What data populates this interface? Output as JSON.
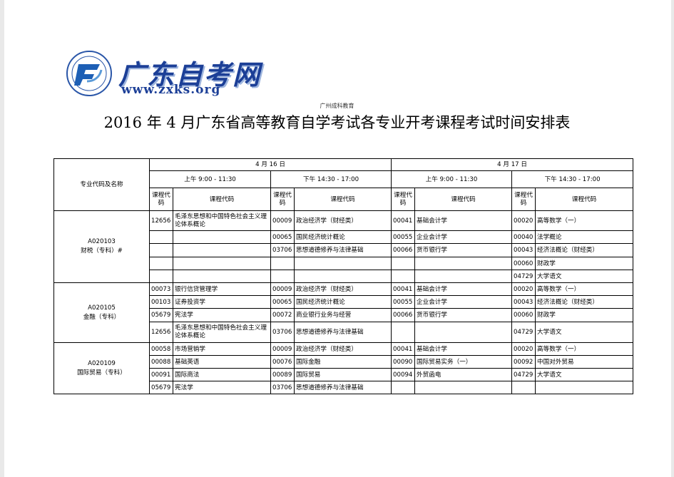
{
  "logo": {
    "title": "广东自考网",
    "url": "www.zxks.org",
    "emblem_icon": "zxks-emblem-icon"
  },
  "source_line": "广州成科教育",
  "title": "2016 年 4 月广东省高等教育自学考试各专业开考课程考试时间安排表",
  "table": {
    "major_header": "专业代码及名称",
    "days": [
      "4 月 16 日",
      "4 月 17 日"
    ],
    "sessions": [
      "上午 9:00 - 11:30",
      "下午 14:30 - 17:00",
      "上午 9:00 - 11:30",
      "下午 14:30 - 17:00"
    ],
    "code_header": "课程代码",
    "name_header": "课程代码",
    "majors": [
      {
        "code": "A020103",
        "name": "财税（专科）#",
        "rows": [
          [
            [
              "12656",
              "毛泽东思想和中国特色社会主义理论体系概论"
            ],
            [
              "00009",
              "政治经济学（财经类）"
            ],
            [
              "00041",
              "基础会计学"
            ],
            [
              "00020",
              "高等数学（一）"
            ]
          ],
          [
            [
              "",
              ""
            ],
            [
              "00065",
              "国民经济统计概论"
            ],
            [
              "00055",
              "企业会计学"
            ],
            [
              "00040",
              "法学概论"
            ]
          ],
          [
            [
              "",
              ""
            ],
            [
              "03706",
              "思想道德修养与法律基础"
            ],
            [
              "00066",
              "货币银行学"
            ],
            [
              "00043",
              "经济法概论（财经类）"
            ]
          ],
          [
            [
              "",
              ""
            ],
            [
              "",
              ""
            ],
            [
              "",
              ""
            ],
            [
              "00060",
              "财政学"
            ]
          ],
          [
            [
              "",
              ""
            ],
            [
              "",
              ""
            ],
            [
              "",
              ""
            ],
            [
              "04729",
              "大学语文"
            ]
          ]
        ]
      },
      {
        "code": "A020105",
        "name": "金融（专科）",
        "rows": [
          [
            [
              "00073",
              "银行信贷管理学"
            ],
            [
              "00009",
              "政治经济学（财经类）"
            ],
            [
              "00041",
              "基础会计学"
            ],
            [
              "00020",
              "高等数学（一）"
            ]
          ],
          [
            [
              "00103",
              "证券投资学"
            ],
            [
              "00065",
              "国民经济统计概论"
            ],
            [
              "00055",
              "企业会计学"
            ],
            [
              "00043",
              "经济法概论（财经类）"
            ]
          ],
          [
            [
              "05679",
              "宪法学"
            ],
            [
              "00072",
              "商业银行业务与经营"
            ],
            [
              "00066",
              "货币银行学"
            ],
            [
              "00060",
              "财政学"
            ]
          ],
          [
            [
              "12656",
              "毛泽东思想和中国特色社会主义理论体系概论"
            ],
            [
              "03706",
              "思想道德修养与法律基础"
            ],
            [
              "",
              ""
            ],
            [
              "04729",
              "大学语文"
            ]
          ]
        ]
      },
      {
        "code": "A020109",
        "name": "国际贸易（专科）",
        "rows": [
          [
            [
              "00058",
              "市场营销学"
            ],
            [
              "00009",
              "政治经济学（财经类）"
            ],
            [
              "00041",
              "基础会计学"
            ],
            [
              "00020",
              "高等数学（一）"
            ]
          ],
          [
            [
              "00088",
              "基础英语"
            ],
            [
              "00076",
              "国际金融"
            ],
            [
              "00090",
              "国际贸易实务（一）"
            ],
            [
              "00092",
              "中国对外贸易"
            ]
          ],
          [
            [
              "00091",
              "国际商法"
            ],
            [
              "00089",
              "国际贸易"
            ],
            [
              "00094",
              "外贸函电"
            ],
            [
              "04729",
              "大学语文"
            ]
          ],
          [
            [
              "05679",
              "宪法学"
            ],
            [
              "03706",
              "思想道德修养与法律基础"
            ],
            [
              "",
              ""
            ],
            [
              "",
              ""
            ]
          ]
        ]
      }
    ]
  }
}
